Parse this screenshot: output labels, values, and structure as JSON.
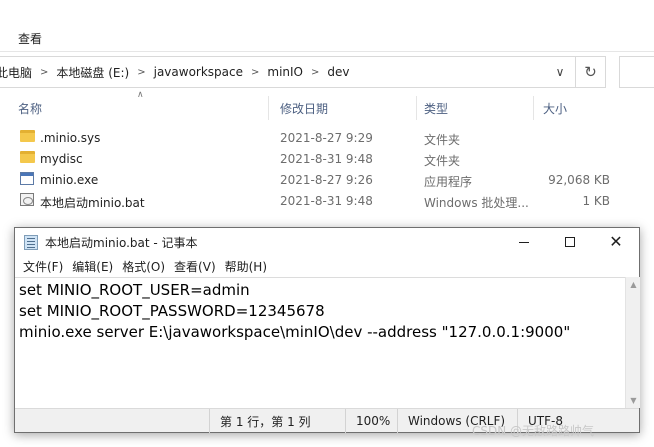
{
  "explorer": {
    "ribbon_tab": "查看",
    "breadcrumb": [
      "此电脑",
      "本地磁盘 (E:)",
      "javaworkspace",
      "minIO",
      "dev"
    ],
    "columns": {
      "name": "名称",
      "modified": "修改日期",
      "type": "类型",
      "size": "大小"
    },
    "files": [
      {
        "name": ".minio.sys",
        "date": "2021-8-27 9:29",
        "type": "文件夹",
        "size": "",
        "icon": "folder-icon"
      },
      {
        "name": "mydisc",
        "date": "2021-8-31 9:48",
        "type": "文件夹",
        "size": "",
        "icon": "folder-icon"
      },
      {
        "name": "minio.exe",
        "date": "2021-8-27 9:26",
        "type": "应用程序",
        "size": "92,068 KB",
        "icon": "exe-icon"
      },
      {
        "name": "本地启动minio.bat",
        "date": "2021-8-31 9:48",
        "type": "Windows 批处理...",
        "size": "1 KB",
        "icon": "bat-icon"
      }
    ]
  },
  "notepad": {
    "title": "本地启动minio.bat - 记事本",
    "menu": [
      "文件(F)",
      "编辑(E)",
      "格式(O)",
      "查看(V)",
      "帮助(H)"
    ],
    "content_lines": [
      "set MINIO_ROOT_USER=admin",
      "set MINIO_ROOT_PASSWORD=12345678",
      "minio.exe server E:\\javaworkspace\\minIO\\dev --address \"127.0.0.1:9000\""
    ],
    "status": {
      "position": "第 1 行，第 1 列",
      "zoom": "100%",
      "line_ending": "Windows (CRLF)",
      "encoding": "UTF-8"
    }
  },
  "watermark": "CSDN @无敌路路帅气"
}
